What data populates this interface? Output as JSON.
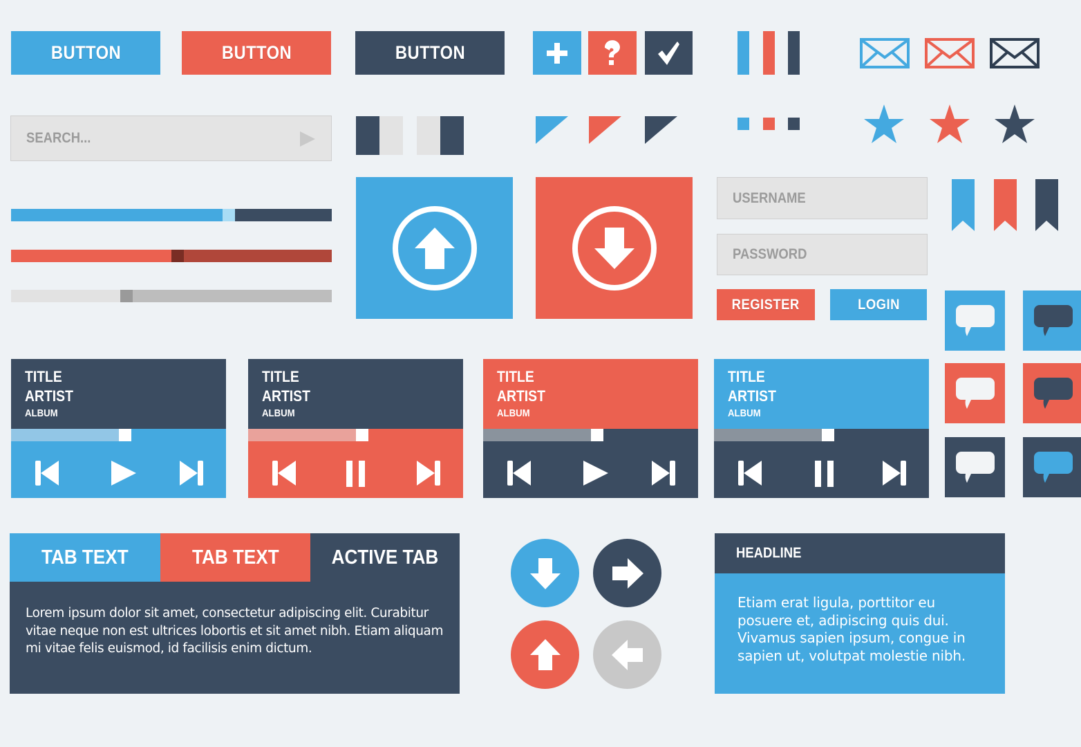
{
  "colors": {
    "blue": "#44a9e0",
    "red": "#eb6150",
    "dark": "#3b4c61",
    "background": "#eef2f5",
    "gray": "#c8c8c8"
  },
  "buttons": [
    {
      "label": "BUTTON",
      "color": "blue"
    },
    {
      "label": "BUTTON",
      "color": "red"
    },
    {
      "label": "BUTTON",
      "color": "dark"
    }
  ],
  "icon_buttons": [
    {
      "icon": "plus-icon",
      "color": "blue"
    },
    {
      "icon": "question-icon",
      "color": "red"
    },
    {
      "icon": "checkmark-icon",
      "color": "dark"
    }
  ],
  "search": {
    "placeholder": "SEARCH...",
    "icon": "play-arrow-icon"
  },
  "sliders": [
    {
      "color": "blue",
      "value_percent": 66
    },
    {
      "color": "red",
      "value_percent": 50
    },
    {
      "color": "gray",
      "value_percent": 34
    }
  ],
  "tiles": [
    {
      "icon": "upload-arrow-icon",
      "color": "blue"
    },
    {
      "icon": "download-arrow-icon",
      "color": "red"
    }
  ],
  "login": {
    "username_placeholder": "USERNAME",
    "password_placeholder": "PASSWORD",
    "register_label": "REGISTER",
    "login_label": "LOGIN"
  },
  "players": [
    {
      "title": "TITLE",
      "artist": "ARTIST",
      "album": "ALBUM",
      "state": "paused",
      "icon": "play-icon",
      "progress_percent": 50
    },
    {
      "title": "TITLE",
      "artist": "ARTIST",
      "album": "ALBUM",
      "state": "playing",
      "icon": "pause-icon",
      "progress_percent": 50
    },
    {
      "title": "TITLE",
      "artist": "ARTIST",
      "album": "ALBUM",
      "state": "paused",
      "icon": "play-icon",
      "progress_percent": 50
    },
    {
      "title": "TITLE",
      "artist": "ARTIST",
      "album": "ALBUM",
      "state": "playing",
      "icon": "pause-icon",
      "progress_percent": 50
    }
  ],
  "tabs": {
    "items": [
      {
        "label": "TAB TEXT",
        "color": "blue"
      },
      {
        "label": "TAB TEXT",
        "color": "red"
      },
      {
        "label": "ACTIVE TAB",
        "color": "dark",
        "active": true
      }
    ],
    "content": "Lorem ipsum dolor sit amet, consectetur adipiscing elit. Curabitur vitae neque non est ultrices lobortis et sit amet nibh. Etiam aliquam mi vitae felis euismod, id facilisis enim dictum."
  },
  "arrow_circles": [
    {
      "icon": "arrow-down-icon",
      "color": "blue"
    },
    {
      "icon": "arrow-right-icon",
      "color": "dark"
    },
    {
      "icon": "arrow-up-icon",
      "color": "red"
    },
    {
      "icon": "arrow-left-icon",
      "color": "gray"
    }
  ],
  "panel": {
    "headline": "HEADLINE",
    "body": "Etiam erat ligula, porttitor eu posuere et, adipiscing quis dui. Vivamus sapien ipsum, congue in sapien ut, volutpat molestie nibh."
  }
}
